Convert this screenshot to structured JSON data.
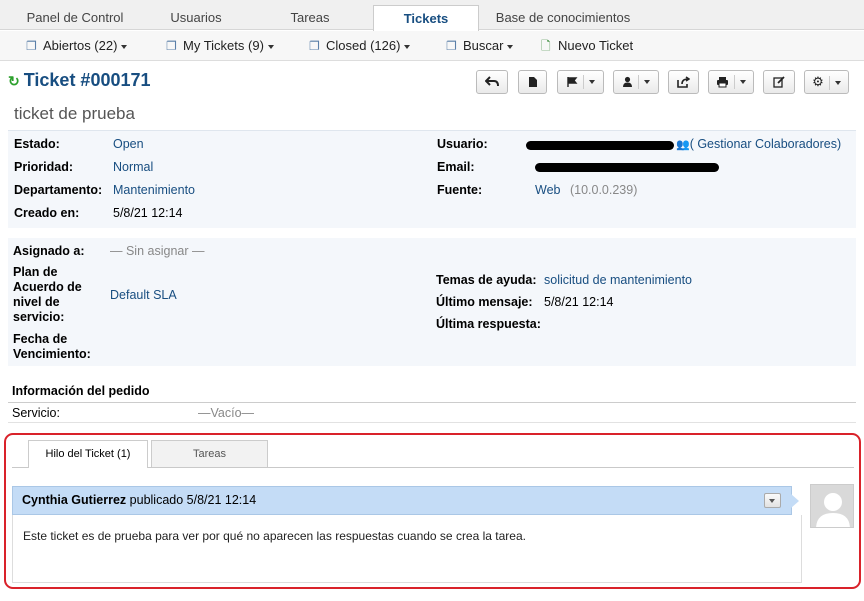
{
  "nav": {
    "tabs": [
      {
        "label": "Panel de Control"
      },
      {
        "label": "Usuarios"
      },
      {
        "label": "Tareas"
      },
      {
        "label": "Tickets",
        "active": true
      },
      {
        "label": "Base de conocimientos"
      }
    ]
  },
  "subnav": {
    "open": "Abiertos (22)",
    "mine": "My Tickets (9)",
    "closed": "Closed (126)",
    "search": "Buscar",
    "new": "Nuevo Ticket"
  },
  "ticket": {
    "number": "Ticket #000171",
    "subject": "ticket de prueba"
  },
  "info": {
    "estado_label": "Estado:",
    "estado": "Open",
    "prioridad_label": "Prioridad:",
    "prioridad": "Normal",
    "departamento_label": "Departamento:",
    "departamento": "Mantenimiento",
    "creado_label": "Creado en:",
    "creado": "5/8/21 12:14",
    "usuario_label": "Usuario:",
    "colaboradores": "( Gestionar Colaboradores)",
    "email_label": "Email:",
    "fuente_label": "Fuente:",
    "fuente": "Web",
    "fuente_ip": "(10.0.0.239)"
  },
  "assign": {
    "asignado_label": "Asignado a:",
    "asignado": "— Sin asignar —",
    "sla_label_1": "Plan de",
    "sla_label_2": "Acuerdo de",
    "sla_label_3": "nivel de",
    "sla_label_4": "servicio:",
    "sla": "Default SLA",
    "vencimiento_label_1": "Fecha de",
    "vencimiento_label_2": "Vencimiento:",
    "temas_label": "Temas de ayuda:",
    "temas": "solicitud de mantenimiento",
    "ultimo_msg_label": "Último mensaje:",
    "ultimo_msg": "5/8/21 12:14",
    "ultima_resp_label": "Última respuesta:"
  },
  "pedido": {
    "title": "Información del pedido",
    "servicio_label": "Servicio:",
    "servicio": "—Vacío—"
  },
  "thread": {
    "tab_thread": "Hilo del Ticket (1)",
    "tab_tasks": "Tareas",
    "author": "Cynthia Gutierrez",
    "posted": "publicado 5/8/21 12:14",
    "body": "Este ticket es de prueba para ver por qué no aparecen las respuestas cuando se crea la tarea."
  },
  "colors": {
    "link": "#184E81",
    "highlight": "#d9222a",
    "message_header": "#c4dcf6"
  }
}
